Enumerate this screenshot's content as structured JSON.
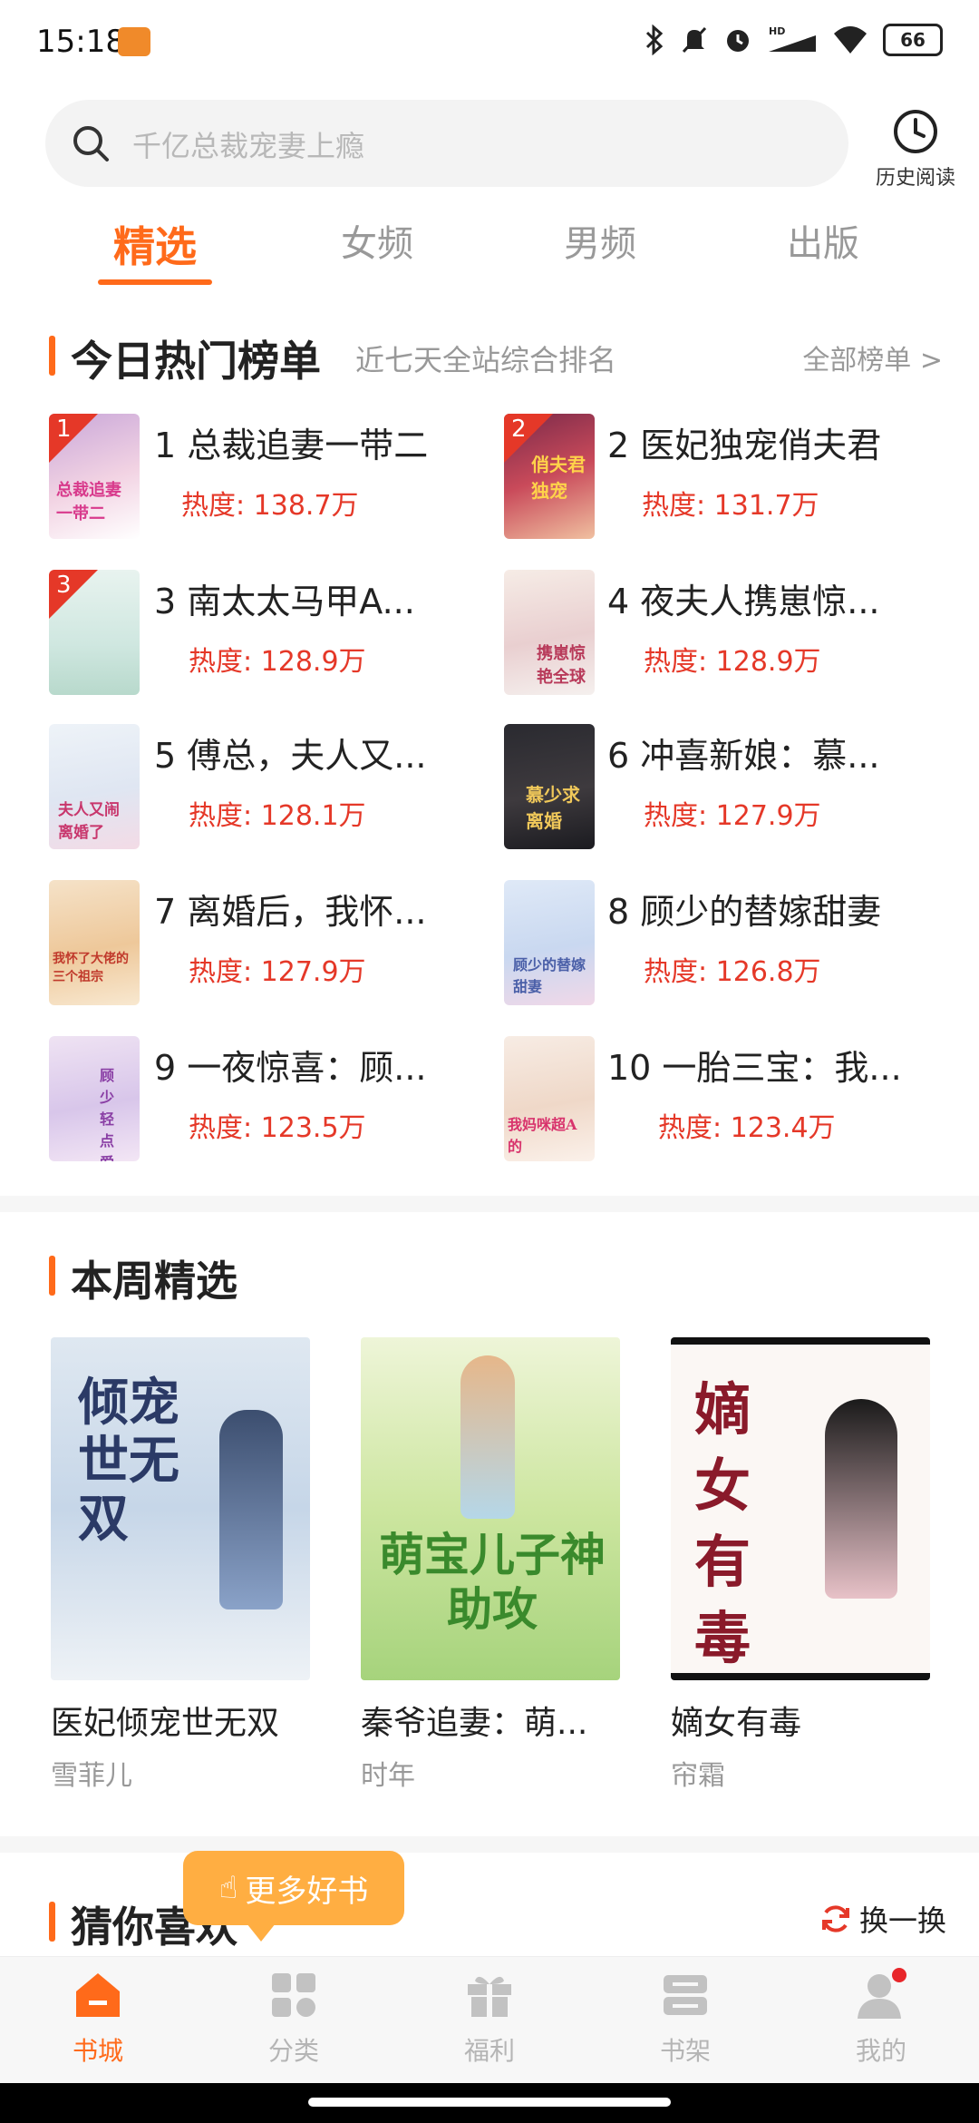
{
  "status": {
    "time": "15:18",
    "battery": "66"
  },
  "search": {
    "placeholder": "千亿总裁宠妻上瘾",
    "history_label": "历史阅读"
  },
  "tabs": [
    {
      "label": "精选"
    },
    {
      "label": "女频"
    },
    {
      "label": "男频"
    },
    {
      "label": "出版"
    }
  ],
  "hot": {
    "title": "今日热门榜单",
    "subtitle": "近七天全站综合排名",
    "more": "全部榜单 >",
    "items": [
      {
        "rank": "1",
        "title": "1 总裁追妻一带二",
        "heat": "热度: 138.7万",
        "cover_text": "总裁追妻一带二"
      },
      {
        "rank": "2",
        "title": "2 医妃独宠俏夫君",
        "heat": "热度: 131.7万",
        "cover_text": "俏夫君独宠"
      },
      {
        "rank": "3",
        "title": "3 南太太马甲A...",
        "heat": "热度: 128.9万",
        "cover_text": ""
      },
      {
        "rank": "",
        "title": "4 夜夫人携崽惊...",
        "heat": "热度: 128.9万",
        "cover_text": "携崽惊艳全球"
      },
      {
        "rank": "",
        "title": "5 傅总，夫人又...",
        "heat": "热度: 128.1万",
        "cover_text": "夫人又闹离婚了"
      },
      {
        "rank": "",
        "title": "6 冲喜新娘：慕...",
        "heat": "热度: 127.9万",
        "cover_text": "慕少求离婚"
      },
      {
        "rank": "",
        "title": "7 离婚后，我怀...",
        "heat": "热度: 127.9万",
        "cover_text": "我怀了大佬的三个祖宗"
      },
      {
        "rank": "",
        "title": "8 顾少的替嫁甜妻",
        "heat": "热度: 126.8万",
        "cover_text": "顾少的替嫁甜妻"
      },
      {
        "rank": "",
        "title": "9 一夜惊喜：顾...",
        "heat": "热度: 123.5万",
        "cover_text": "顾少轻点爱"
      },
      {
        "rank": "",
        "title": "10 一胎三宝：我...",
        "heat": "热度: 123.4万",
        "cover_text": "我妈咪超A的"
      }
    ]
  },
  "weekly": {
    "title": "本周精选",
    "books": [
      {
        "title": "医妃倾宠世无双",
        "author": "雪菲儿",
        "cover_text": "倾宠世无双"
      },
      {
        "title": "秦爷追妻：萌...",
        "author": "时年",
        "cover_text": "萌宝儿子神助攻"
      },
      {
        "title": "嫡女有毒",
        "author": "帘霜",
        "cover_text": "嫡女有毒"
      }
    ]
  },
  "guess": {
    "title": "猜你喜欢",
    "refresh": "换一换",
    "tooltip": "更多好书"
  },
  "nav": [
    {
      "label": "书城"
    },
    {
      "label": "分类"
    },
    {
      "label": "福利"
    },
    {
      "label": "书架"
    },
    {
      "label": "我的"
    }
  ]
}
